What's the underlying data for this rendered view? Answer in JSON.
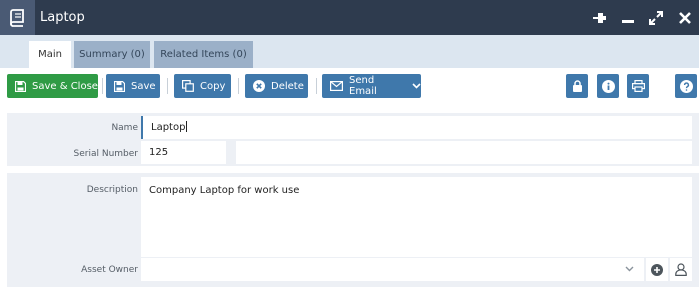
{
  "window": {
    "title": "Laptop",
    "icons": [
      "book-icon",
      "pin-icon",
      "minimize-icon",
      "maximize-icon",
      "close-icon"
    ]
  },
  "tabs": [
    {
      "label": "Main",
      "active": true
    },
    {
      "label": "Summary (0)",
      "active": false
    },
    {
      "label": "Related Items (0)",
      "active": false
    }
  ],
  "toolbar": {
    "save_close": "Save & Close",
    "save": "Save",
    "copy": "Copy",
    "delete": "Delete",
    "send_email": "Send Email"
  },
  "form": {
    "name_label": "Name",
    "name_value": "Laptop",
    "serial_label": "Serial Number",
    "serial_value": "125",
    "description_label": "Description",
    "description_value": "Company Laptop for work use",
    "asset_owner_label": "Asset Owner",
    "asset_owner_value": ""
  },
  "colors": {
    "titlebar": "#2e3b4e",
    "accent": "#3f78ab",
    "save_green": "#2f9b45",
    "tab_strip": "#dce6f0",
    "form_bg": "#edf0f5"
  }
}
